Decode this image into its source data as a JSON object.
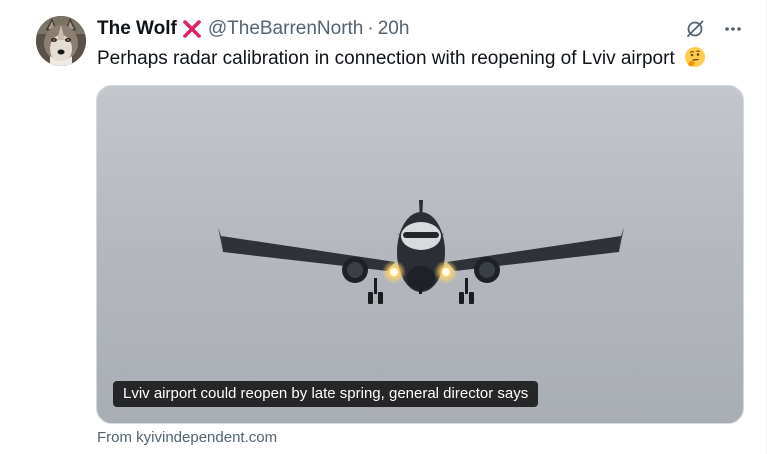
{
  "tweet": {
    "author_name": "The Wolf",
    "author_badge_icon": "red-cross-icon",
    "handle": "@TheBarrenNorth",
    "separator": "·",
    "time": "20h",
    "text": "Perhaps radar calibration in connection with reopening of Lviv airport",
    "emoji_icon": "thinking-face-icon"
  },
  "actions": {
    "grok_icon": "grok-icon",
    "more_icon": "more-icon"
  },
  "card": {
    "image_subject": "passenger jet airplane approaching with landing lights on against overcast sky",
    "headline": "Lviv airport could reopen by late spring, general director says",
    "source": "From kyivindependent.com"
  },
  "colors": {
    "text_primary": "#0f1419",
    "text_secondary": "#536471",
    "badge_red": "#e0245e",
    "card_border": "#cfd9de"
  }
}
